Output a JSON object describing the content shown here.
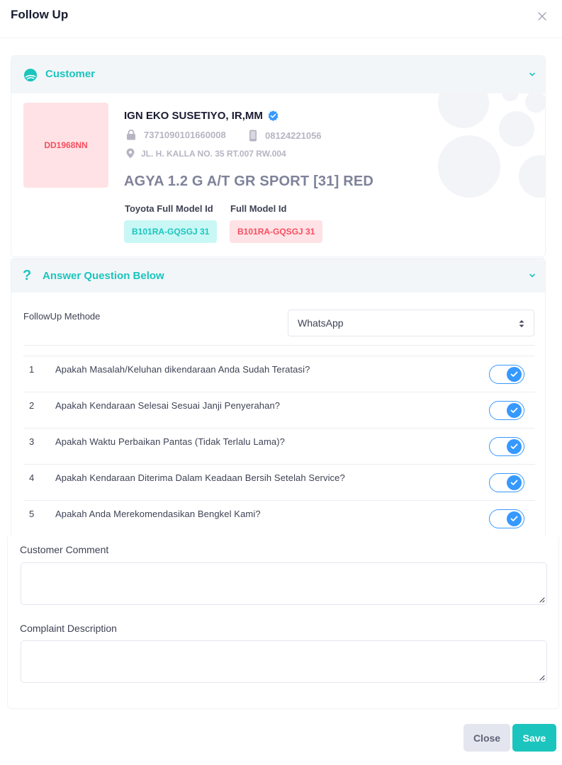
{
  "modal": {
    "title": "Follow Up"
  },
  "customer": {
    "section_title": "Customer",
    "plate": "DD1968NN",
    "name": "IGN EKO SUSETIYO, IR,MM",
    "id_number": "7371090101660008",
    "phone": "08124221056",
    "address": "JL. H. KALLA NO. 35 RT.007 RW.004",
    "model": "AGYA 1.2 G A/T GR SPORT [31] RED",
    "toyota_model_label": "Toyota Full Model Id",
    "toyota_model_value": "B101RA-GQSGJ 31",
    "full_model_label": "Full Model Id",
    "full_model_value": "B101RA-GQSGJ 31"
  },
  "answer": {
    "section_title": "Answer Question Below",
    "method_label": "FollowUp Methode",
    "method_value": "WhatsApp",
    "questions": [
      {
        "num": "1",
        "text": "Apakah Masalah/Keluhan dikendaraan Anda Sudah Teratasi?",
        "checked": true
      },
      {
        "num": "2",
        "text": "Apakah Kendaraan Selesai Sesuai Janji Penyerahan?",
        "checked": true
      },
      {
        "num": "3",
        "text": "Apakah Waktu Perbaikan Pantas (Tidak Terlalu Lama)?",
        "checked": true
      },
      {
        "num": "4",
        "text": "Apakah Kendaraan Diterima Dalam Keadaan Bersih Setelah Service?",
        "checked": true
      },
      {
        "num": "5",
        "text": "Apakah Anda Merekomendasikan Bengkel Kami?",
        "checked": true
      }
    ]
  },
  "comments": {
    "customer_comment_label": "Customer Comment",
    "customer_comment_value": "",
    "complaint_label": "Complaint Description",
    "complaint_value": ""
  },
  "footer": {
    "close_label": "Close",
    "save_label": "Save"
  },
  "colors": {
    "accent": "#1bc5bd",
    "danger": "#f64e60",
    "primary": "#3699ff"
  }
}
